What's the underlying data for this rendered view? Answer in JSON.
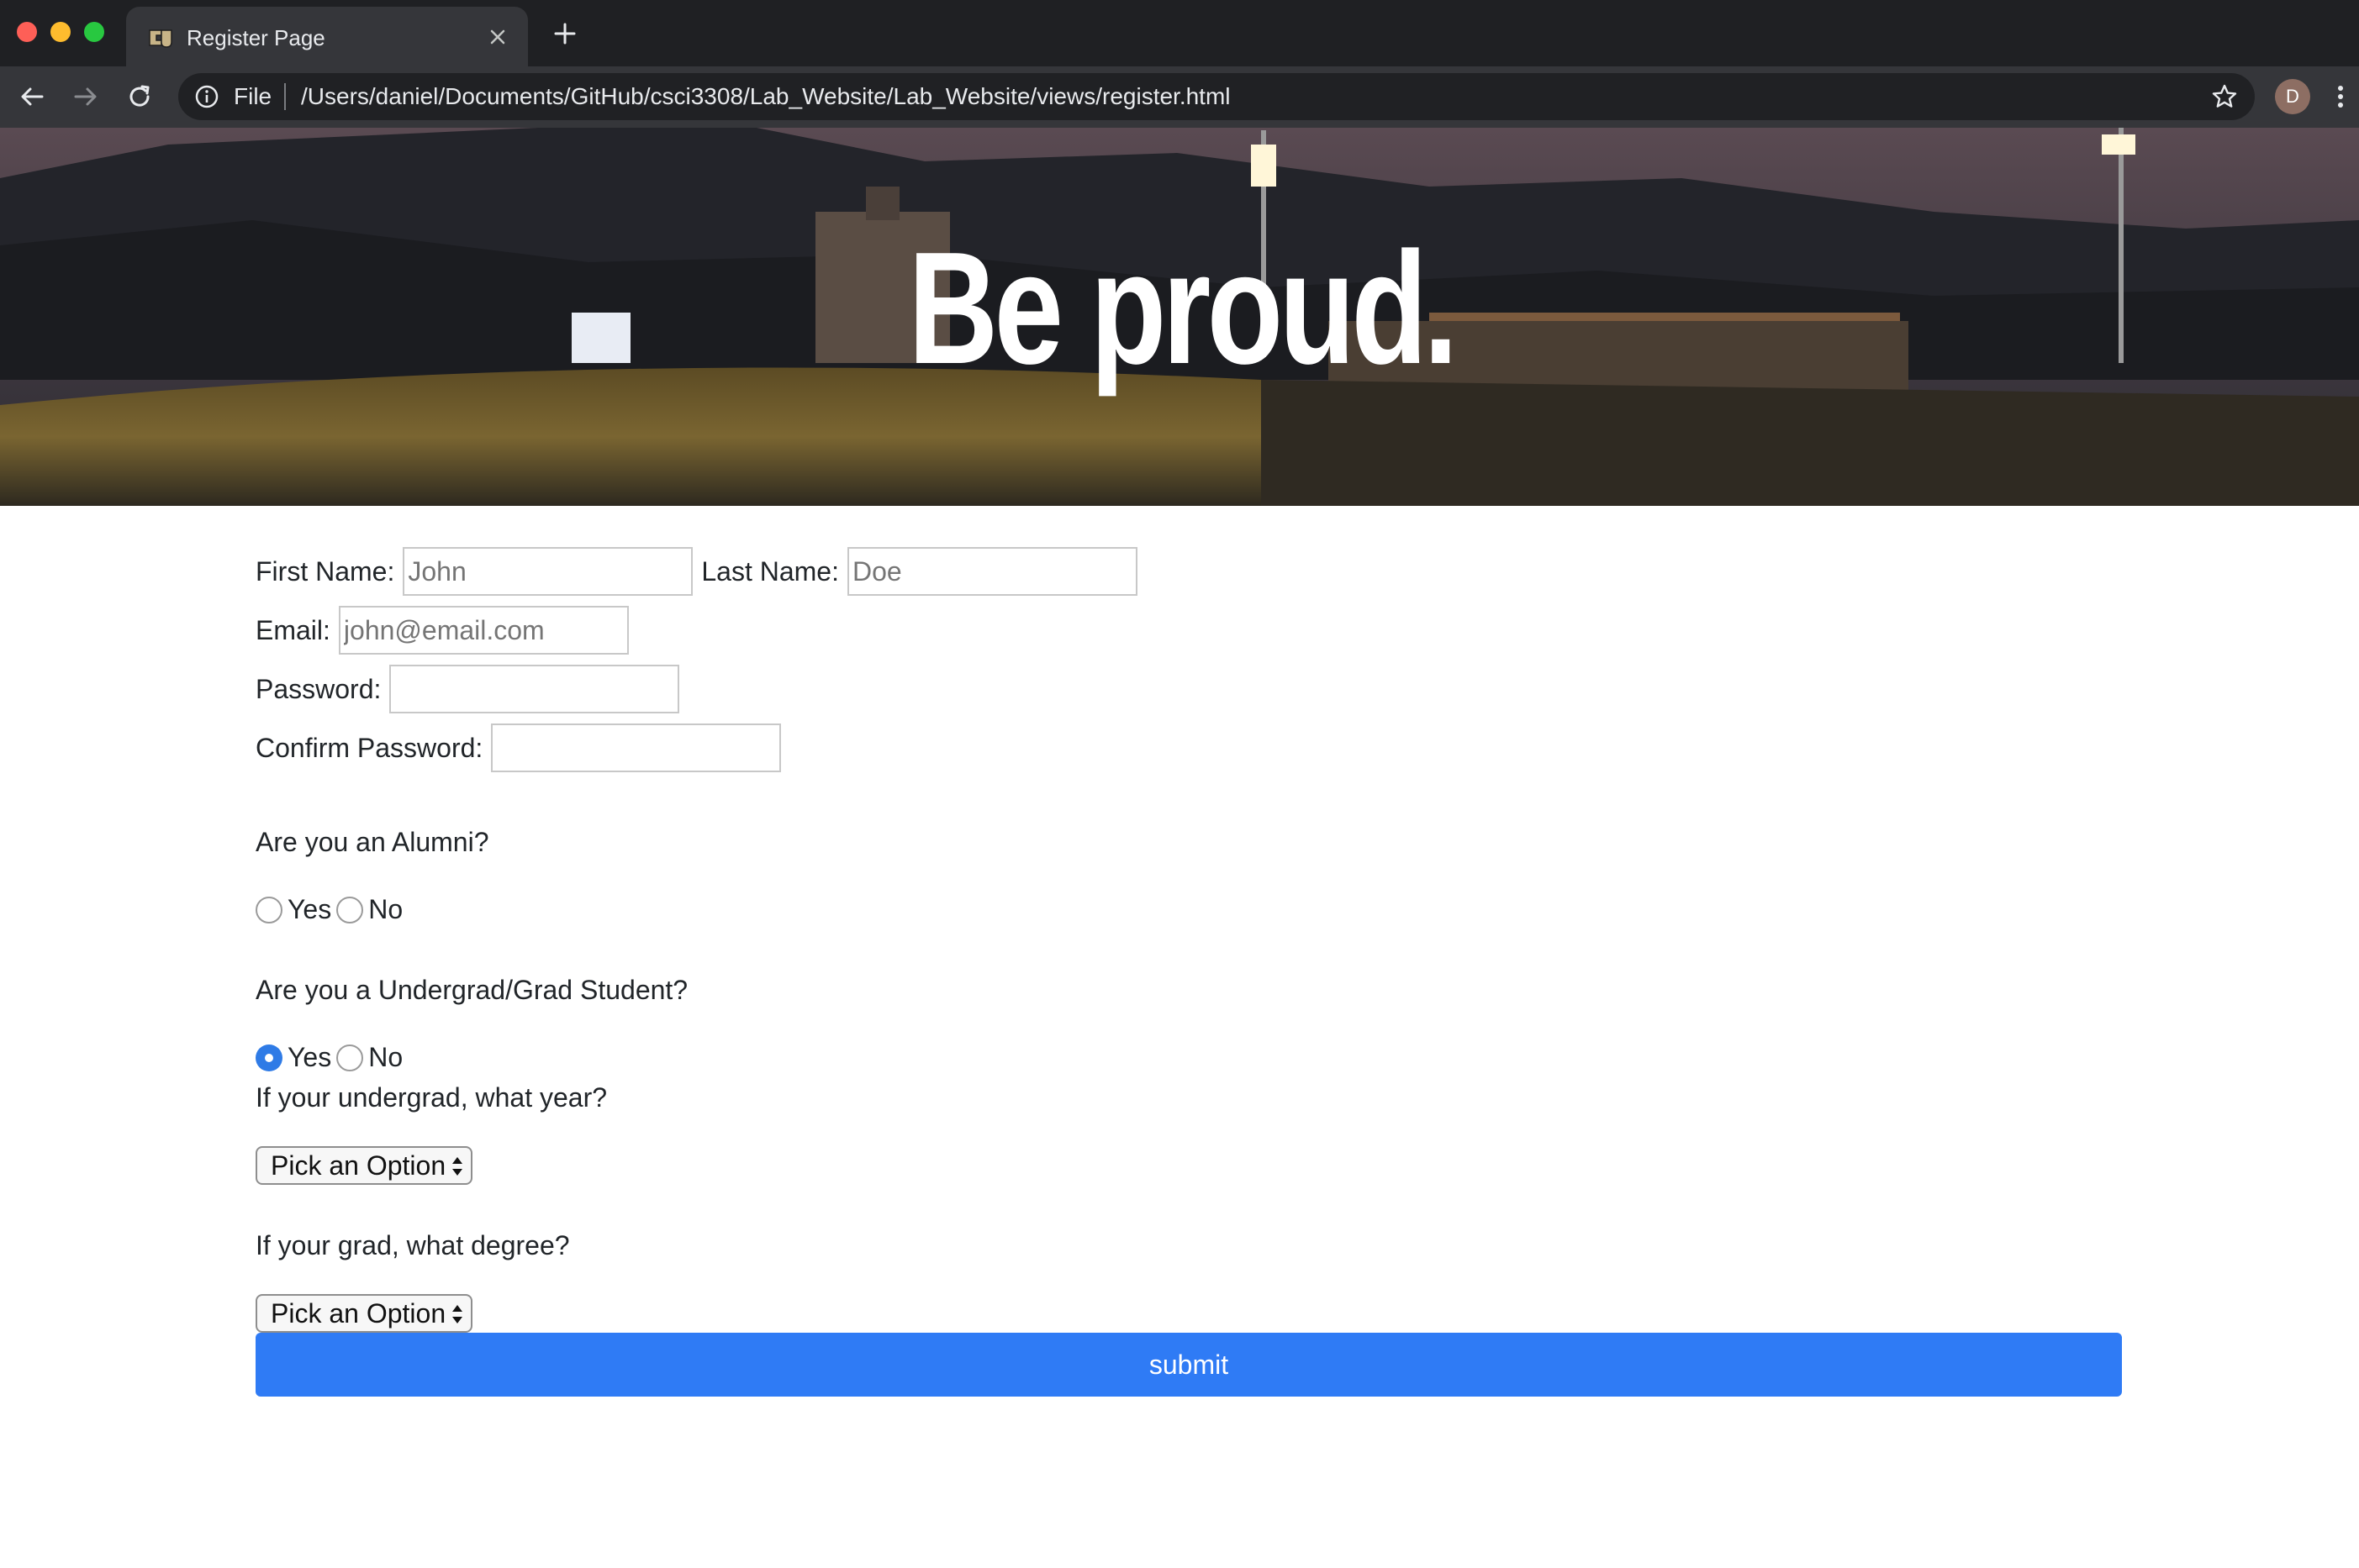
{
  "browser": {
    "tab_title": "Register Page",
    "url_scheme_label": "File",
    "url": "/Users/daniel/Documents/GitHub/csci3308/Lab_Website/Lab_Website/views/register.html",
    "profile_initial": "D"
  },
  "hero": {
    "title": "Be proud."
  },
  "form": {
    "first_name": {
      "label": "First Name:",
      "placeholder": "John",
      "value": ""
    },
    "last_name": {
      "label": "Last Name:",
      "placeholder": "Doe",
      "value": ""
    },
    "email": {
      "label": "Email:",
      "placeholder": "john@email.com",
      "value": ""
    },
    "password": {
      "label": "Password:",
      "placeholder": "",
      "value": ""
    },
    "confirm_password": {
      "label": "Confirm Password:",
      "placeholder": "",
      "value": ""
    },
    "alumni": {
      "question": "Are you an Alumni?",
      "options": [
        {
          "label": "Yes",
          "selected": false
        },
        {
          "label": "No",
          "selected": false
        }
      ]
    },
    "student": {
      "question": "Are you a Undergrad/Grad Student?",
      "options": [
        {
          "label": "Yes",
          "selected": true
        },
        {
          "label": "No",
          "selected": false
        }
      ]
    },
    "undergrad_year": {
      "question": "If your undergrad, what year?",
      "selected": "Pick an Option"
    },
    "grad_degree": {
      "question": "If your grad, what degree?",
      "selected": "Pick an Option"
    },
    "submit_label": "submit"
  },
  "colors": {
    "primary": "#2f7bf5",
    "radio_selected": "#2f7be6",
    "chrome_dark": "#1f2023",
    "chrome_toolbar": "#35363a"
  }
}
